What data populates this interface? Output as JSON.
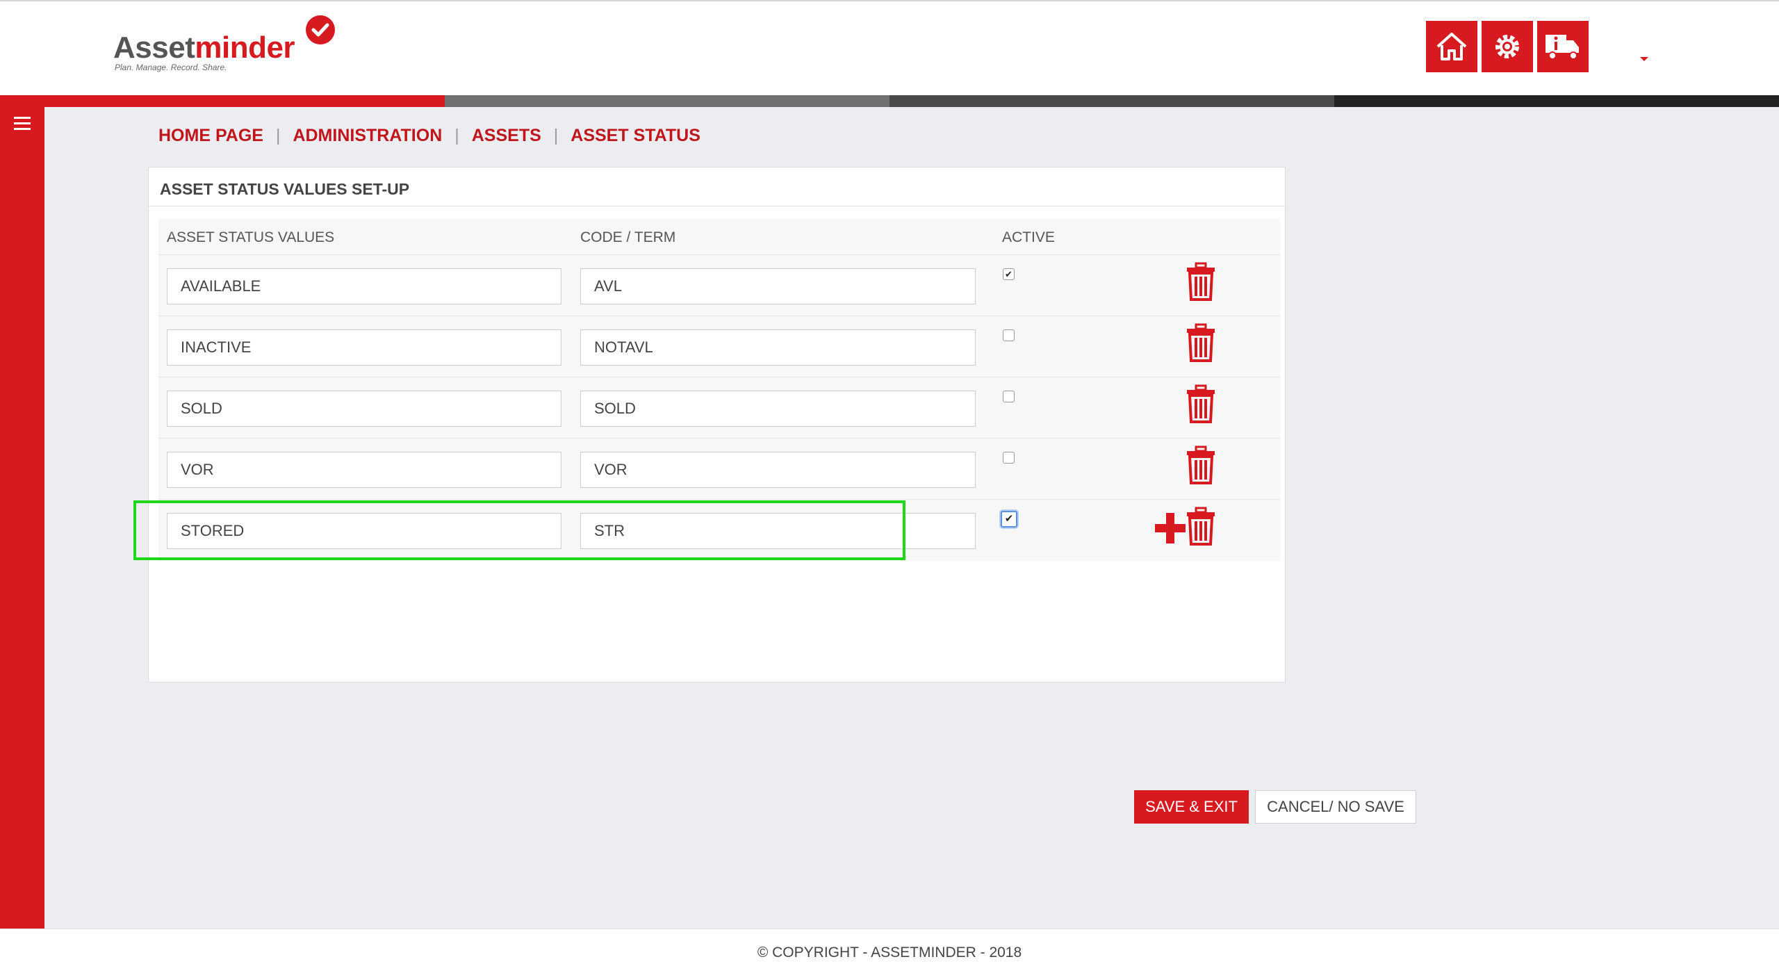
{
  "header": {
    "logo_word_a": "Asset",
    "logo_word_b": "minder",
    "logo_tagline": "Plan. Manage. Record. Share.",
    "icons": [
      "home-icon",
      "settings-icon",
      "truck-info-icon"
    ]
  },
  "breadcrumb": {
    "items": [
      "HOME PAGE",
      "ADMINISTRATION",
      "ASSETS",
      "ASSET STATUS"
    ],
    "separator": "|"
  },
  "panel": {
    "title": "ASSET STATUS VALUES SET-UP",
    "columns": {
      "values": "ASSET STATUS VALUES",
      "code": "CODE / TERM",
      "active": "ACTIVE"
    },
    "rows": [
      {
        "value": "AVAILABLE",
        "code": "AVL",
        "active": true
      },
      {
        "value": "INACTIVE",
        "code": "NOTAVL",
        "active": false
      },
      {
        "value": "SOLD",
        "code": "SOLD",
        "active": false
      },
      {
        "value": "VOR",
        "code": "VOR",
        "active": false
      },
      {
        "value": "STORED",
        "code": "STR",
        "active": true
      }
    ],
    "save_label": "SAVE & EXIT",
    "cancel_label": "CANCEL/ NO SAVE"
  },
  "footer": {
    "copyright": "© COPYRIGHT - ASSETMINDER - 2018"
  },
  "colors": {
    "brand_red": "#d71920",
    "highlight_green": "#1ed71a"
  }
}
